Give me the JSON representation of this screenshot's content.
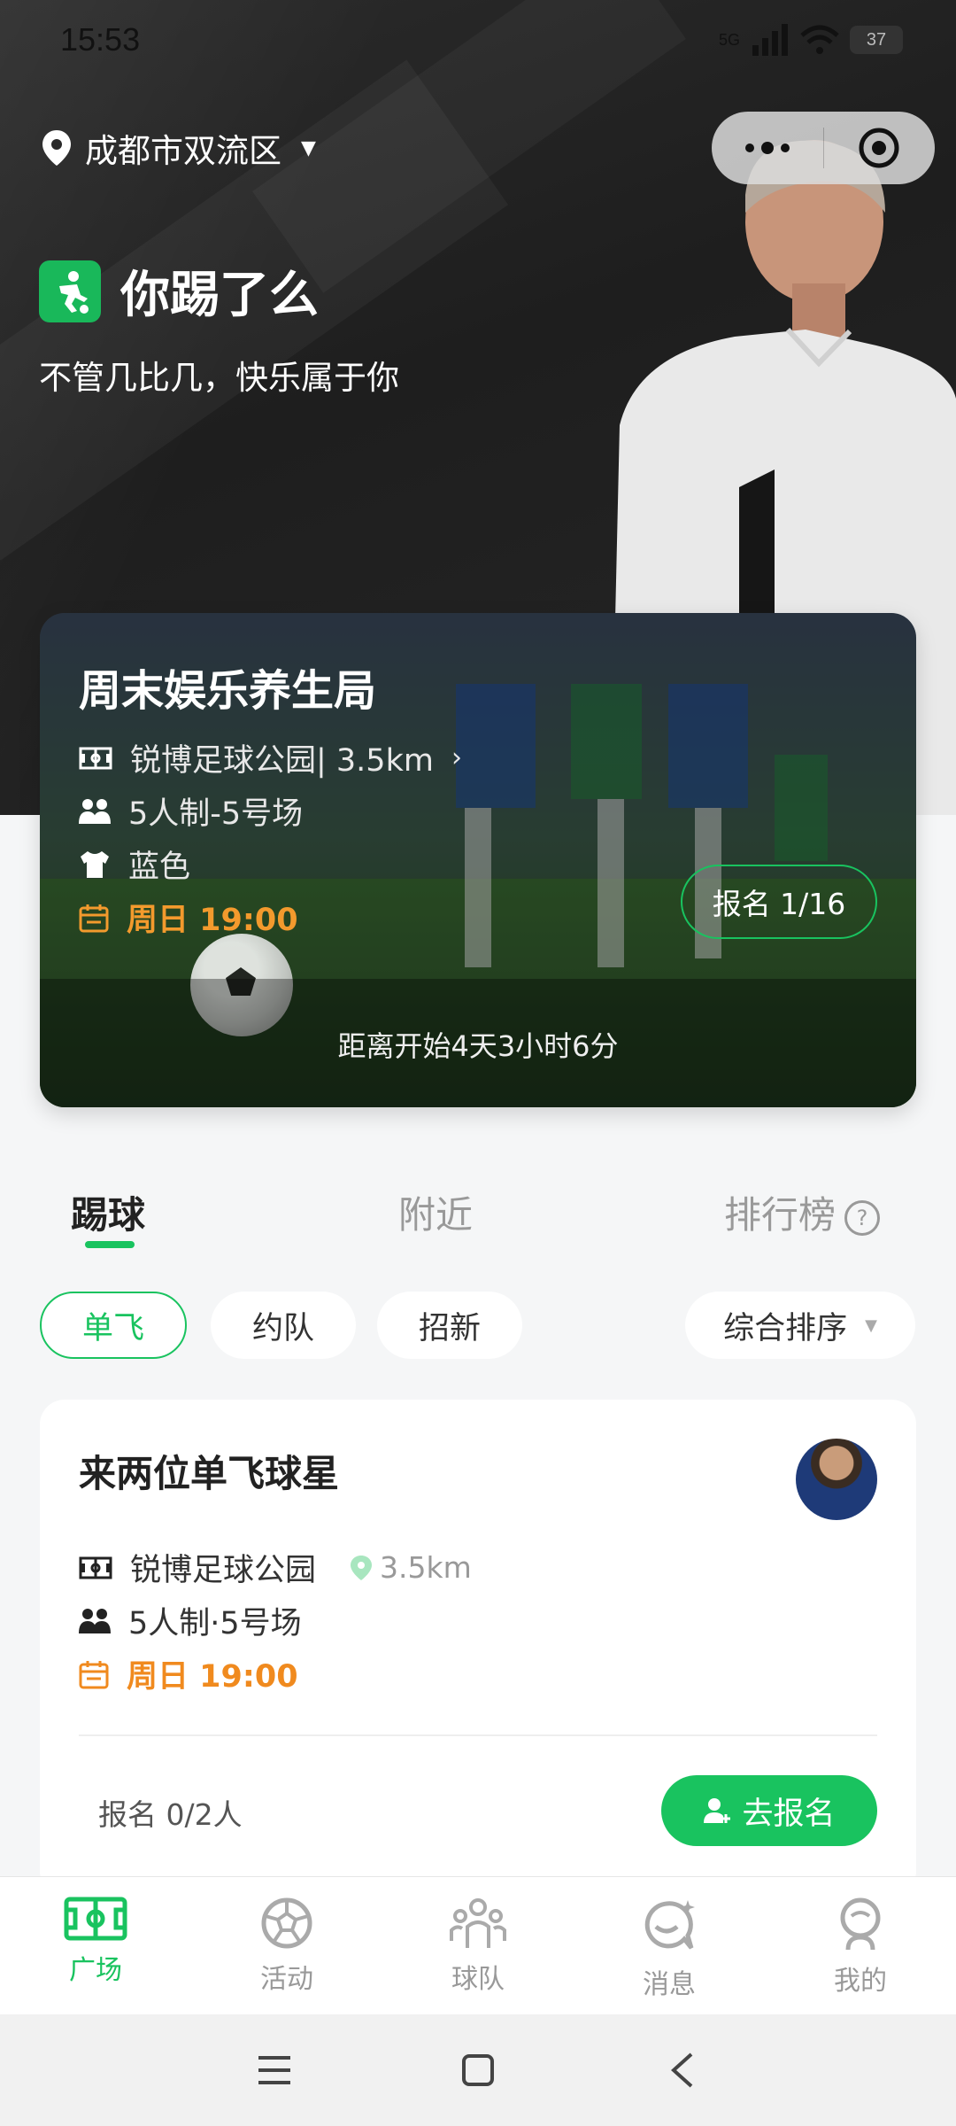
{
  "status_bar": {
    "time": "15:53",
    "network": "5G",
    "battery": "37"
  },
  "header": {
    "location": "成都市双流区",
    "brand_name": "你踢了么",
    "slogan": "不管几比几，快乐属于你"
  },
  "featured_event": {
    "title": "周末娱乐养生局",
    "venue": "锐博足球公园| 3.5km",
    "format": "5人制-5号场",
    "jersey_color": "蓝色",
    "time": "周日 19:00",
    "signup_label": "报名 1/16",
    "countdown": "距离开始4天3小时6分"
  },
  "tabs": [
    {
      "label": "踢球",
      "active": true
    },
    {
      "label": "附近",
      "active": false
    },
    {
      "label": "排行榜",
      "active": false
    }
  ],
  "filters": {
    "chips": [
      {
        "label": "单飞",
        "active": true
      },
      {
        "label": "约队",
        "active": false
      },
      {
        "label": "招新",
        "active": false
      }
    ],
    "sort_label": "综合排序"
  },
  "match_card": {
    "title": "来两位单飞球星",
    "venue": "锐博足球公园",
    "distance": "3.5km",
    "format": "5人制·5号场",
    "time": "周日 19:00",
    "signup_count": "报名 0/2人",
    "join_label": "去报名"
  },
  "bottom_nav": [
    {
      "label": "广场",
      "icon": "field-icon",
      "active": true
    },
    {
      "label": "活动",
      "icon": "ball-icon",
      "active": false
    },
    {
      "label": "球队",
      "icon": "team-icon",
      "active": false
    },
    {
      "label": "消息",
      "icon": "message-icon",
      "active": false
    },
    {
      "label": "我的",
      "icon": "profile-icon",
      "active": false
    }
  ],
  "colors": {
    "accent": "#19c35f",
    "time": "#f08a1e",
    "hero_bg": "#222222"
  }
}
